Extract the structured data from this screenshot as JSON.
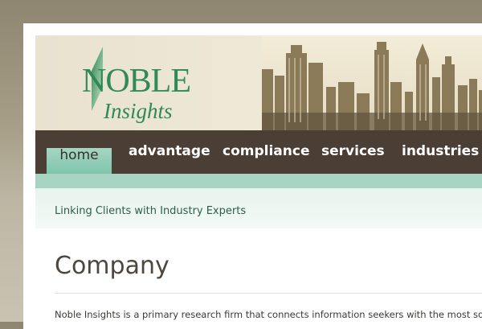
{
  "logo": {
    "line1": "NOBLE",
    "line2": "Insights",
    "brand_color": "#2f8a55"
  },
  "nav": {
    "items": [
      {
        "label": "home",
        "active": true
      },
      {
        "label": "advantage",
        "active": false
      },
      {
        "label": "compliance",
        "active": false
      },
      {
        "label": "services",
        "active": false
      },
      {
        "label": "industries",
        "active": false
      }
    ],
    "bar_color": "#4a3e35",
    "active_color": "#8fcdb6"
  },
  "tagline": "Linking Clients with Industry Experts",
  "main": {
    "title": "Company",
    "intro": "Noble Insights is a primary research firm that connects information seekers with the most sough"
  }
}
